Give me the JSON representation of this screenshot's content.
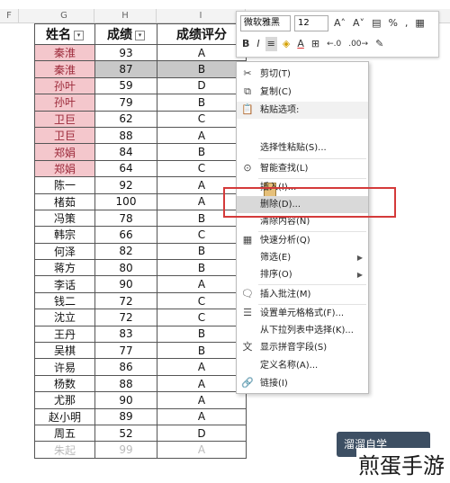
{
  "columns": [
    "F",
    "G",
    "H",
    "I"
  ],
  "sheet": {
    "headers": [
      "姓名",
      "成绩",
      "成绩评分"
    ],
    "filter_glyph": "▾",
    "rows": [
      {
        "name": "秦淮",
        "score": "93",
        "grade": "A"
      },
      {
        "name": "秦淮",
        "score": "87",
        "grade": "B"
      },
      {
        "name": "孙叶",
        "score": "59",
        "grade": "D"
      },
      {
        "name": "孙叶",
        "score": "79",
        "grade": "B"
      },
      {
        "name": "卫巨",
        "score": "62",
        "grade": "C"
      },
      {
        "name": "卫巨",
        "score": "88",
        "grade": "A"
      },
      {
        "name": "郑娟",
        "score": "84",
        "grade": "B"
      },
      {
        "name": "郑娟",
        "score": "64",
        "grade": "C"
      },
      {
        "name": "陈一",
        "score": "92",
        "grade": "A"
      },
      {
        "name": "楮茹",
        "score": "100",
        "grade": "A"
      },
      {
        "name": "冯策",
        "score": "78",
        "grade": "B"
      },
      {
        "name": "韩宗",
        "score": "66",
        "grade": "C"
      },
      {
        "name": "何泽",
        "score": "82",
        "grade": "B"
      },
      {
        "name": "蒋方",
        "score": "80",
        "grade": "B"
      },
      {
        "name": "李话",
        "score": "90",
        "grade": "A"
      },
      {
        "name": "钱二",
        "score": "72",
        "grade": "C"
      },
      {
        "name": "沈立",
        "score": "72",
        "grade": "C"
      },
      {
        "name": "王丹",
        "score": "83",
        "grade": "B"
      },
      {
        "name": "吴棋",
        "score": "77",
        "grade": "B"
      },
      {
        "name": "许易",
        "score": "86",
        "grade": "A"
      },
      {
        "name": "杨数",
        "score": "88",
        "grade": "A"
      },
      {
        "name": "尤那",
        "score": "90",
        "grade": "A"
      },
      {
        "name": "赵小明",
        "score": "89",
        "grade": "A"
      },
      {
        "name": "周五",
        "score": "52",
        "grade": "D"
      },
      {
        "name": "朱起",
        "score": "99",
        "grade": "A"
      }
    ],
    "highlight_color": "#f4c7cc"
  },
  "mini_toolbar": {
    "font_name": "微软雅黑",
    "font_size": "12",
    "grow_font": "A˄",
    "shrink_font": "A˅",
    "percent": "%",
    "comma": ",",
    "bold": "B",
    "italic": "I",
    "font_color": "A",
    "dec_inc": "←.0",
    "dec_dec": ".00→"
  },
  "context_menu": {
    "items": [
      {
        "label": "剪切(T)",
        "icon": "scissors-icon",
        "glyph": "✂"
      },
      {
        "label": "复制(C)",
        "icon": "copy-icon",
        "glyph": "⧉"
      },
      {
        "label": "粘贴选项:",
        "icon": "paste-icon",
        "glyph": "📋"
      },
      {
        "label": "选择性粘贴(S)...",
        "icon": "",
        "glyph": ""
      },
      {
        "label": "智能查找(L)",
        "icon": "search-icon",
        "glyph": "⊙"
      },
      {
        "label": "插入(I)...",
        "icon": "",
        "glyph": ""
      },
      {
        "label": "删除(D)...",
        "icon": "",
        "glyph": ""
      },
      {
        "label": "清除内容(N)",
        "icon": "",
        "glyph": ""
      },
      {
        "label": "快速分析(Q)",
        "icon": "quick-analysis-icon",
        "glyph": "▦"
      },
      {
        "label": "筛选(E)",
        "icon": "",
        "glyph": "",
        "submenu": "▶"
      },
      {
        "label": "排序(O)",
        "icon": "",
        "glyph": "",
        "submenu": "▶"
      },
      {
        "label": "插入批注(M)",
        "icon": "comment-icon",
        "glyph": "🗨"
      },
      {
        "label": "设置单元格格式(F)...",
        "icon": "format-cells-icon",
        "glyph": "☰"
      },
      {
        "label": "从下拉列表中选择(K)...",
        "icon": "",
        "glyph": ""
      },
      {
        "label": "显示拼音字段(S)",
        "icon": "phonetic-icon",
        "glyph": "文"
      },
      {
        "label": "定义名称(A)...",
        "icon": "",
        "glyph": ""
      },
      {
        "label": "链接(I)",
        "icon": "link-icon",
        "glyph": "🔗"
      }
    ]
  },
  "watermark": {
    "logo": "溜溜自学",
    "text": "煎蛋手游"
  }
}
